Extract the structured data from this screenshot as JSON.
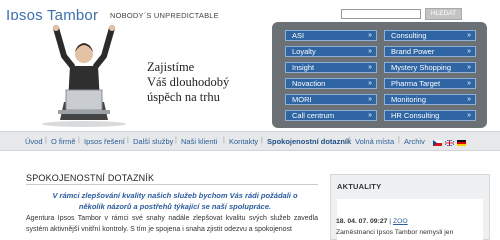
{
  "header": {
    "logo": "Ipsos Tambor",
    "tagline": "NOBODY´S UNPREDICTABLE",
    "search_placeholder": "",
    "search_button": "HLEDAT"
  },
  "hero": {
    "slogan_line1": "Zajistíme",
    "slogan_line2": "Váš dlouhodobý",
    "slogan_line3": "úspěch na trhu"
  },
  "panel": {
    "left": [
      "ASI",
      "Loyalty",
      "Insight",
      "Novaction",
      "MORI",
      "Call centrum"
    ],
    "right": [
      "Consulting",
      "Brand Power",
      "Mystery Shopping",
      "Pharma Target",
      "Monitoring",
      "HR Consulting"
    ],
    "arrow": "»"
  },
  "nav": {
    "items": [
      "Úvod",
      "O firmě",
      "Ipsos řešení",
      "Další služby",
      "Naši klienti",
      "Kontakty",
      "Spokojenostní dotazník",
      "Volná místa",
      "Archiv"
    ],
    "separator": "|",
    "active_index": 6
  },
  "main": {
    "title": "SPOKOJENOSTNÍ DOTAZNÍK",
    "lead": "V rámci zlepšování kvality našich služeb bychom Vás rádi požádali o několik názorů a postřehů týkající se naší spolupráce.",
    "body": "Agentura Ipsos Tambor v rámci své snahy nadále zlepšovat kvalitu svých služeb zavedla systém aktivnější vnitřní kontroly. S tím je spojena i snaha zjistit odezvu a spokojenost"
  },
  "news": {
    "title": "AKTUALITY",
    "date": "18. 04. 07. 09:27",
    "separator": "|",
    "link": "ZOO",
    "text": "Zaměstnanci Ipsos Tambor nemysli jen"
  },
  "colors": {
    "brand_blue": "#3d6fb0",
    "panel_gray": "#6b7075",
    "button_blue": "#2f65a3",
    "nav_bg": "#e6e8ea",
    "lead_blue": "#2a5b9c"
  }
}
